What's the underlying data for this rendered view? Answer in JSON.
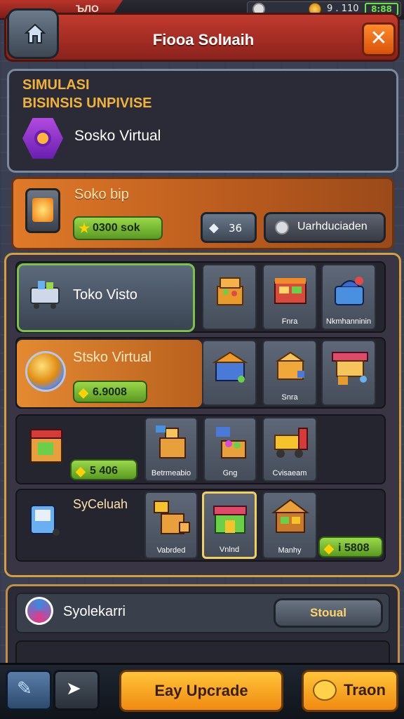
{
  "status": {
    "left_text": "ЪЛО",
    "coins": "9 . 110",
    "battery": "8:88",
    "icons": [
      "diamond-icon",
      "coin-icon",
      "battery-icon"
    ]
  },
  "header": {
    "title": "Fіооа Sоlиаіh",
    "close": "✕"
  },
  "intro": {
    "line1": "SIMULASI",
    "line2": "BISINSIS UNPIVISE",
    "name": "Sosko Virtual"
  },
  "shop": {
    "name": "Soko bip",
    "coins": "0300 sok",
    "gem_value": "36",
    "upgrade_label": "Uarhduciaden"
  },
  "rows": {
    "row1": {
      "feature_label": "Toko Visto",
      "cards": [
        {
          "label": ""
        },
        {
          "label": "Fnra"
        },
        {
          "label": "Nkmhanninin"
        }
      ]
    },
    "row2": {
      "feature_label": "Stsko Virtual",
      "coins": "6.9008",
      "cards": [
        {
          "label": ""
        },
        {
          "label": "Snra"
        },
        {
          "label": ""
        }
      ]
    },
    "row3": {
      "coins": "5 406",
      "cards": [
        {
          "label": "Betrmeabio"
        },
        {
          "label": "Gng"
        },
        {
          "label": "Cvisaeam"
        }
      ]
    },
    "row4": {
      "feature_label": "SyCeluah",
      "coins": "i 5808",
      "cards": [
        {
          "label": "Vabrded"
        },
        {
          "label": "Vnlnd"
        },
        {
          "label": "Manhy"
        }
      ]
    }
  },
  "bottom": {
    "label": "Syolekarri",
    "button": "Stoual"
  },
  "actions": {
    "easy_upgrade": "Eay Upcrade",
    "train": "Traon"
  },
  "colors": {
    "header": "#c23a2e",
    "accent_orange": "#f08a10",
    "accent_green": "#7ac24a",
    "panel_dark": "#2a2b36"
  }
}
